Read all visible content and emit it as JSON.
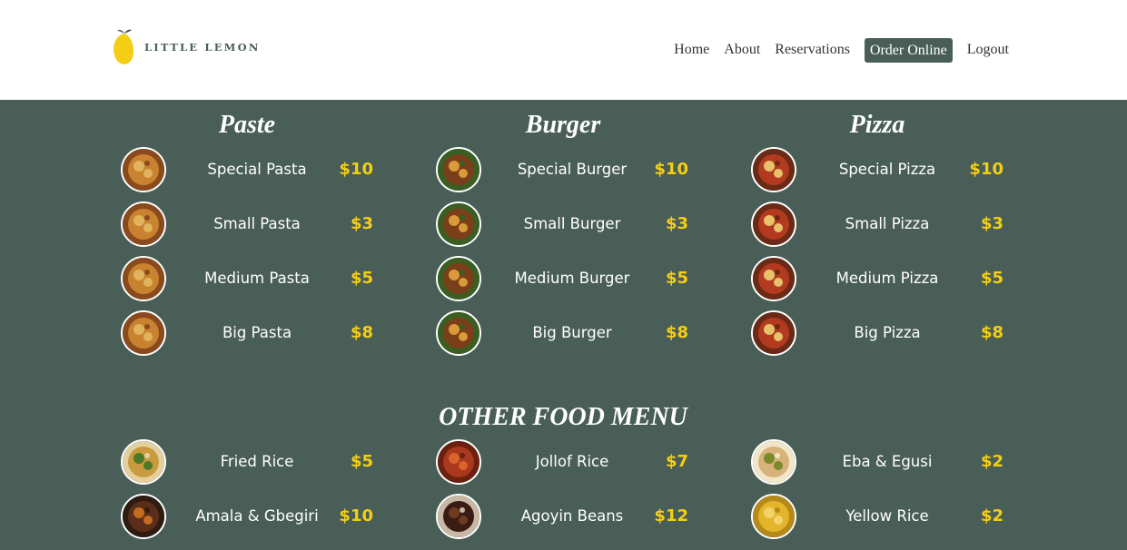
{
  "brand": {
    "name": "LITTLE LEMON",
    "accent": "#f4ce14",
    "primary": "#495e57"
  },
  "nav": {
    "items": [
      "Home",
      "About",
      "Reservations",
      "Order Online",
      "Logout"
    ],
    "active": "Order Online"
  },
  "categories": [
    {
      "title": "Paste",
      "items": [
        {
          "name": "Special Pasta",
          "price": "$10",
          "icon": "pasta-thumbnail"
        },
        {
          "name": "Small Pasta",
          "price": "$3",
          "icon": "pasta-thumbnail"
        },
        {
          "name": "Medium Pasta",
          "price": "$5",
          "icon": "pasta-thumbnail"
        },
        {
          "name": "Big Pasta",
          "price": "$8",
          "icon": "pasta-thumbnail"
        }
      ]
    },
    {
      "title": "Burger",
      "items": [
        {
          "name": "Special Burger",
          "price": "$10",
          "icon": "burger-thumbnail"
        },
        {
          "name": "Small Burger",
          "price": "$3",
          "icon": "burger-thumbnail"
        },
        {
          "name": "Medium Burger",
          "price": "$5",
          "icon": "burger-thumbnail"
        },
        {
          "name": "Big Burger",
          "price": "$8",
          "icon": "burger-thumbnail"
        }
      ]
    },
    {
      "title": "Pizza",
      "items": [
        {
          "name": "Special Pizza",
          "price": "$10",
          "icon": "pizza-thumbnail"
        },
        {
          "name": "Small Pizza",
          "price": "$3",
          "icon": "pizza-thumbnail"
        },
        {
          "name": "Medium Pizza",
          "price": "$5",
          "icon": "pizza-thumbnail"
        },
        {
          "name": "Big Pizza",
          "price": "$8",
          "icon": "pizza-thumbnail"
        }
      ]
    }
  ],
  "other": {
    "title": "OTHER FOOD MENU",
    "columns": [
      [
        {
          "name": "Fried Rice",
          "price": "$5",
          "icon": "fried-rice-thumbnail"
        },
        {
          "name": "Amala & Gbegiri",
          "price": "$10",
          "icon": "amala-thumbnail"
        }
      ],
      [
        {
          "name": "Jollof Rice",
          "price": "$7",
          "icon": "jollof-rice-thumbnail"
        },
        {
          "name": "Agoyin Beans",
          "price": "$12",
          "icon": "beans-thumbnail"
        }
      ],
      [
        {
          "name": "Eba & Egusi",
          "price": "$2",
          "icon": "eba-egusi-thumbnail"
        },
        {
          "name": "Yellow Rice",
          "price": "$2",
          "icon": "yellow-rice-thumbnail"
        }
      ]
    ]
  }
}
